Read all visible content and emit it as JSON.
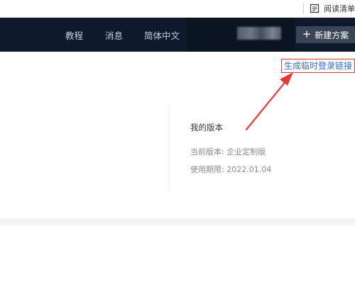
{
  "browser": {
    "reading_list_label": "阅读清单",
    "reading_list_icon": "reading-list-icon"
  },
  "header": {
    "nav": [
      "教程",
      "消息",
      "简体中文"
    ],
    "new_plan_label": "新建方案",
    "new_plan_icon": "plus-icon"
  },
  "main": {
    "temp_login_link": "生成临时登录链接",
    "version": {
      "title": "我的版本",
      "current_label": "当前版本:",
      "current_value": "企业定制版",
      "expiry_label": "使用期限:",
      "expiry_value": "2022.01.04"
    }
  },
  "colors": {
    "header_bg": "#0e1a2b",
    "link": "#2f6fd8",
    "annotation_red": "#e53935"
  }
}
